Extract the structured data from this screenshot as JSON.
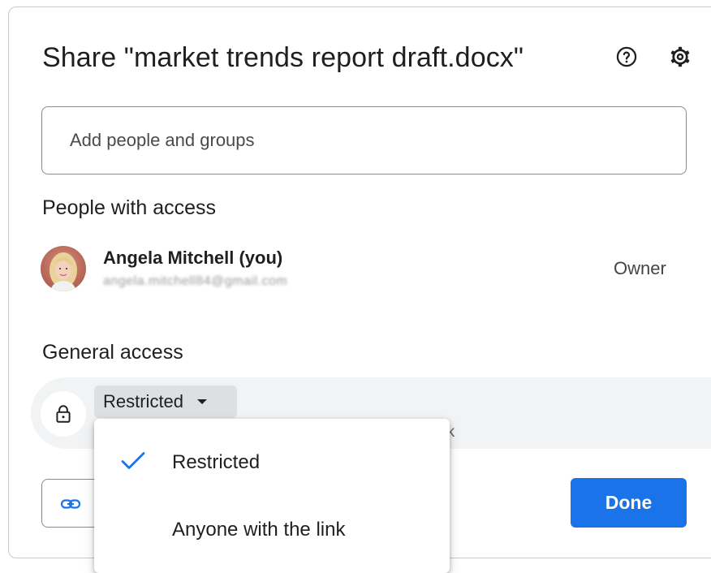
{
  "dialog": {
    "title": "Share \"market trends report draft.docx\"",
    "help_icon": "help-circle-icon",
    "settings_icon": "gear-icon"
  },
  "add_people": {
    "placeholder": "Add people and groups",
    "value": ""
  },
  "people_section": {
    "heading": "People with access",
    "people": [
      {
        "name": "Angela Mitchell (you)",
        "email": "angela.mitchell84@gmail.com",
        "role": "Owner"
      }
    ]
  },
  "general_access": {
    "heading": "General access",
    "selected": "Restricted",
    "description": "nk",
    "lock_icon": "lock-icon"
  },
  "menu": {
    "options": [
      {
        "label": "Restricted",
        "selected": true
      },
      {
        "label": "Anyone with the link",
        "selected": false
      }
    ]
  },
  "footer": {
    "copy_link_icon": "link-icon",
    "done_label": "Done"
  },
  "colors": {
    "accent": "#1a73e8",
    "check": "#1a73e8",
    "access_row_bg": "#f1f3f4"
  }
}
